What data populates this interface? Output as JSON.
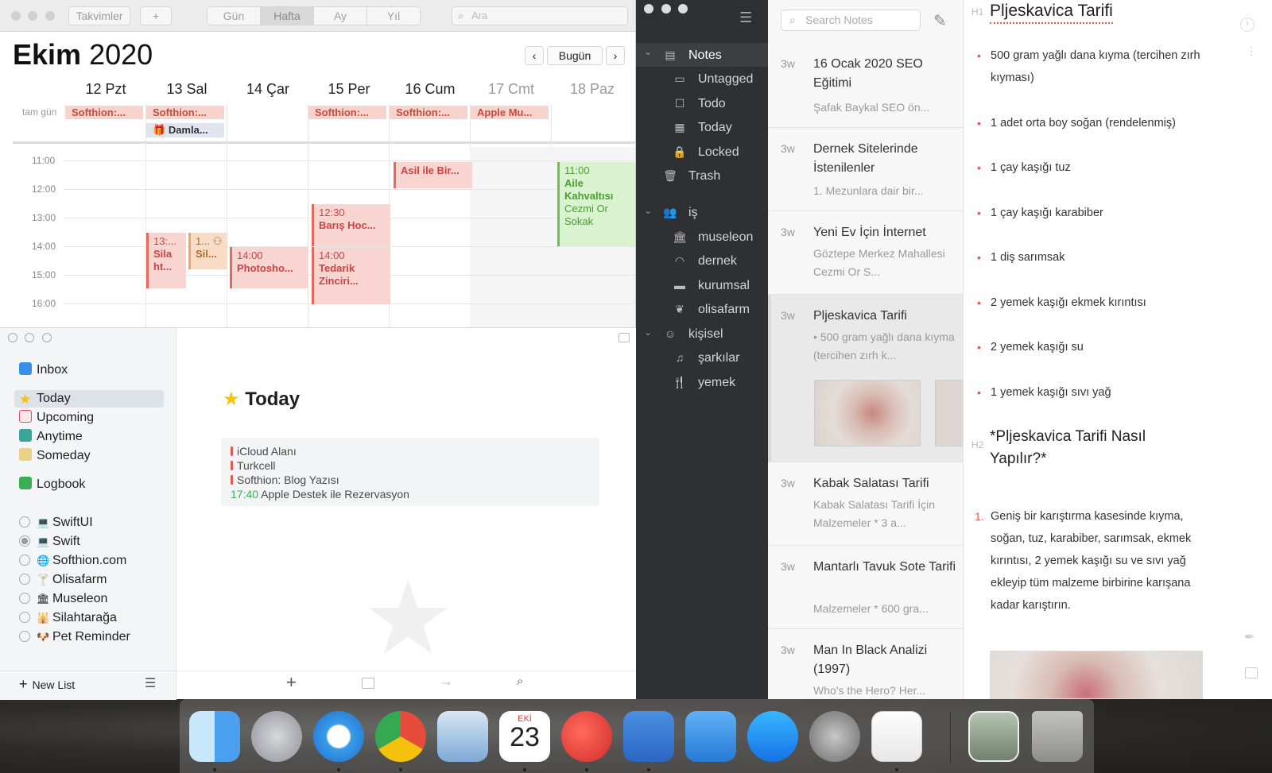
{
  "calendar": {
    "calendars_btn": "Takvimler",
    "add_btn": "+",
    "views": [
      "Gün",
      "Hafta",
      "Ay",
      "Yıl"
    ],
    "active_view": "Hafta",
    "search_placeholder": "Ara",
    "month_bold": "Ekim",
    "year": "2020",
    "today_btn": "Bugün",
    "prev": "‹",
    "next": "›",
    "days": [
      "12 Pzt",
      "13 Sal",
      "14 Çar",
      "15 Per",
      "16 Cum",
      "17 Cmt",
      "18 Paz"
    ],
    "allday_label": "tam gün",
    "allday_events": [
      "Softhion:...",
      "Softhion:...",
      "Softhion:...",
      "Softhion:...",
      "Apple Mu...",
      "Damla..."
    ],
    "hours": [
      "11:00",
      "12:00",
      "13:00",
      "14:00",
      "15:00",
      "16:00"
    ],
    "timed_events": [
      {
        "time": "",
        "title": "Asil ile Bir..."
      },
      {
        "time": "11:00",
        "title": "Aile Kahvaltısı",
        "sub": "Cezmi Or Sokak"
      },
      {
        "time": "12:30",
        "title": "Barış Hoc..."
      },
      {
        "time": "13:...",
        "title": "Sila ht..."
      },
      {
        "time": "1...",
        "title": "Sil..."
      },
      {
        "time": "14:00",
        "title": "Photosho..."
      },
      {
        "time": "14:00",
        "title": "Tedarik Zinciri..."
      }
    ]
  },
  "things": {
    "sidebar": {
      "inbox": "Inbox",
      "today": "Today",
      "upcoming": "Upcoming",
      "anytime": "Anytime",
      "someday": "Someday",
      "logbook": "Logbook",
      "lists": [
        "SwiftUI",
        "Swift",
        "Softhion.com",
        "Olisafarm",
        "Museleon",
        "Silahtarağa",
        "Pet Reminder"
      ],
      "new_list": "New List"
    },
    "main": {
      "title": "Today",
      "events": [
        "iCloud Alanı",
        "Turkcell",
        "Softhion: Blog Yazısı"
      ],
      "timed_event_time": "17:40",
      "timed_event_title": "Apple Destek ile Rezervasyon"
    }
  },
  "bear": {
    "sidebar": {
      "notes": "Notes",
      "untagged": "Untagged",
      "todo": "Todo",
      "today": "Today",
      "locked": "Locked",
      "trash": "Trash",
      "tag_is": "iş",
      "is_children": [
        "museleon",
        "dernek",
        "kurumsal",
        "olisafarm"
      ],
      "tag_kisisel": "kişisel",
      "kisisel_children": [
        "şarkılar",
        "yemek"
      ]
    },
    "search_placeholder": "Search Notes",
    "notes": [
      {
        "age": "3w",
        "title": "16 Ocak 2020 SEO Eğitimi",
        "preview": "Şafak Baykal SEO ön..."
      },
      {
        "age": "3w",
        "title": "Dernek Sitelerinde İstenilenler",
        "preview": "1. Mezunlara dair bir..."
      },
      {
        "age": "3w",
        "title": "Yeni Ev İçin İnternet",
        "preview": "Göztepe Merkez Mahallesi Cezmi Or S..."
      },
      {
        "age": "3w",
        "title": "Pljeskavica Tarifi",
        "preview": "• 500 gram yağlı dana kıyma (tercihen zırh k..."
      },
      {
        "age": "3w",
        "title": "Kabak Salatası Tarifi",
        "preview": "Kabak Salatası Tarifi İçin Malzemeler * 3 a..."
      },
      {
        "age": "3w",
        "title": "Mantarlı Tavuk Sote Tarifi",
        "preview": "Malzemeler * 600 gra..."
      },
      {
        "age": "3w",
        "title": "Man In Black Analizi (1997)",
        "preview": "Who's the Hero? Her..."
      }
    ],
    "editor": {
      "h1_marker": "H1",
      "title": "Pljeskavica Tarifi",
      "ingredients": [
        "500 gram yağlı dana kıyma (tercihen zırh kıyması)",
        "1 adet orta boy soğan (rendelenmiş)",
        "1 çay kaşığı tuz",
        "1 çay kaşığı karabiber",
        "1 diş sarımsak",
        "2 yemek kaşığı ekmek kırıntısı",
        "2 yemek kaşığı su",
        "1 yemek kaşığı sıvı yağ"
      ],
      "h2_marker": "H2",
      "subtitle": "*Pljeskavica Tarifi Nasıl Yapılır?*",
      "step_num": "1.",
      "step1": "Geniş bir karıştırma kasesinde kıyma, soğan, tuz, karabiber, sarımsak, ekmek kırıntısı, 2 yemek kaşığı su ve sıvı yağ ekleyip tüm malzeme birbirine karışana kadar karıştırın."
    }
  },
  "dock": {
    "calendar_month": "EKİ",
    "calendar_day": "23"
  }
}
